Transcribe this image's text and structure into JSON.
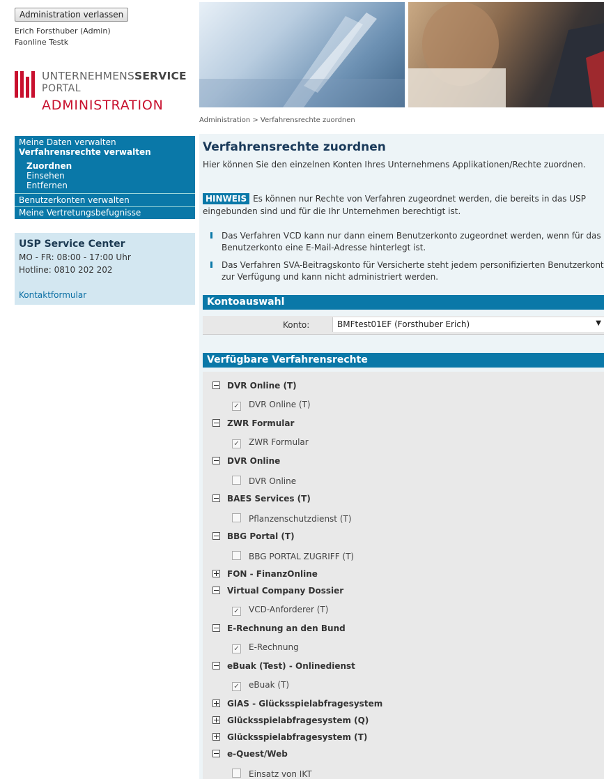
{
  "header": {
    "exit_button": "Administration verlassen",
    "user": "Erich Forsthuber (Admin)",
    "org": "Faonline Testk"
  },
  "logo": {
    "line1_a": "UNTERNEHMENS",
    "line1_b": "SERVICE",
    "line2": "PORTAL",
    "line3": "ADMINISTRATION"
  },
  "nav": {
    "items": [
      {
        "label": "Meine Daten verwalten"
      },
      {
        "label": "Verfahrensrechte verwalten"
      },
      {
        "label": "Benutzerkonten verwalten"
      },
      {
        "label": "Meine Vertretungsbefugnisse"
      }
    ],
    "subitems": [
      {
        "label": "Zuordnen"
      },
      {
        "label": "Einsehen"
      },
      {
        "label": "Entfernen"
      }
    ]
  },
  "service": {
    "title": "USP Service Center",
    "hours": "MO - FR: 08:00 - 17:00 Uhr",
    "hotline": "Hotline: 0810 202 202",
    "link": "Kontaktformular"
  },
  "breadcrumb": "Administration  >  Verfahrensrechte zuordnen",
  "main": {
    "title": "Verfahrensrechte zuordnen",
    "intro": "Hier können Sie den einzelnen Konten Ihres Unternehmens Applikationen/Rechte zuordnen.",
    "hinweis_tag": "HINWEIS",
    "hinweis_text": "Es können nur Rechte von Verfahren zugeordnet werden, die bereits in das USP eingebunden sind und für die Ihr Unternehmen berechtigt ist.",
    "notes": [
      "Das Verfahren VCD kann nur dann einem Benutzerkonto zugeordnet werden, wenn für das Benutzerkonto eine E-Mail-Adresse hinterlegt ist.",
      "Das Verfahren SVA-Beitragskonto für Versicherte steht jedem personifizierten Benutzerkonto zur Verfügung und kann nicht administriert werden."
    ],
    "kontoauswahl": {
      "header": "Kontoauswahl",
      "label": "Konto:",
      "value": "BMFtest01EF (Forsthuber Erich)"
    },
    "verfuegbar_header": "Verfügbare Verfahrensrechte",
    "groups": [
      {
        "label": "DVR Online (T)",
        "expanded": true,
        "items": [
          {
            "label": "DVR Online (T)",
            "checked": true
          }
        ]
      },
      {
        "label": "ZWR Formular",
        "expanded": true,
        "items": [
          {
            "label": "ZWR Formular",
            "checked": true
          }
        ]
      },
      {
        "label": "DVR Online",
        "expanded": true,
        "items": [
          {
            "label": "DVR Online",
            "checked": false
          }
        ]
      },
      {
        "label": "BAES Services (T)",
        "expanded": true,
        "items": [
          {
            "label": "Pflanzenschutzdienst (T)",
            "checked": false
          }
        ]
      },
      {
        "label": "BBG Portal (T)",
        "expanded": true,
        "items": [
          {
            "label": "BBG PORTAL ZUGRIFF (T)",
            "checked": false
          }
        ]
      },
      {
        "label": "FON - FinanzOnline",
        "expanded": false,
        "items": []
      },
      {
        "label": "Virtual Company Dossier",
        "expanded": true,
        "items": [
          {
            "label": "VCD-Anforderer (T)",
            "checked": true
          }
        ]
      },
      {
        "label": "E-Rechnung an den Bund",
        "expanded": true,
        "items": [
          {
            "label": "E-Rechnung",
            "checked": true
          }
        ]
      },
      {
        "label": "eBuak (Test) - Onlinedienst",
        "expanded": true,
        "items": [
          {
            "label": "eBuak (T)",
            "checked": true
          }
        ]
      },
      {
        "label": "GlAS - Glücksspielabfragesystem",
        "expanded": false,
        "items": []
      },
      {
        "label": "Glücksspielabfragesystem (Q)",
        "expanded": false,
        "items": []
      },
      {
        "label": "Glücksspielabfragesystem (T)",
        "expanded": false,
        "items": []
      },
      {
        "label": "e-Quest/Web",
        "expanded": true,
        "items": [
          {
            "label": "Einsatz von IKT",
            "checked": false
          }
        ]
      }
    ]
  }
}
